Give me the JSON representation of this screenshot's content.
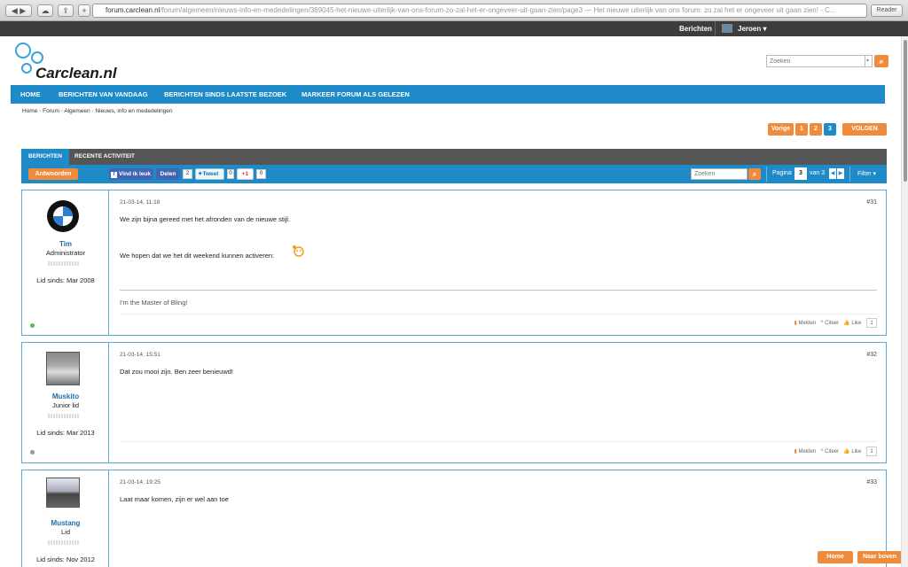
{
  "browser": {
    "url_host": "forum.carclean.nl",
    "url_path": "/forum/algemeen/nieuws-info-en-mededelingen/389045-het-nieuwe-uiterlijk-van-ons-forum-zo-zal-het-er-ongeveer-uit-gaan-zien/page3 — Het nieuwe uiterlijk van ons forum: zo zal het er ongeveer uit gaan zien! - C...",
    "reader": "Reader"
  },
  "topbar": {
    "berichten": "Berichten",
    "user": "Jeroen"
  },
  "logo": "Carclean.nl",
  "search": {
    "placeholder": "Zoeken"
  },
  "nav": {
    "items": [
      "HOME",
      "BERICHTEN VAN VANDAAG",
      "BERICHTEN SINDS LAATSTE BEZOEK",
      "MARKEER FORUM ALS GELEZEN"
    ]
  },
  "breadcrumb": {
    "items": [
      "Home",
      "Forum",
      "Algemeen",
      "Nieuws, info en mededelingen"
    ]
  },
  "pagination": {
    "prev": "Vorige",
    "pages": [
      "1",
      "2",
      "3"
    ],
    "follow": "VOLGEN"
  },
  "tabs": [
    "BERICHTEN",
    "RECENTE ACTIVITEIT"
  ],
  "toolbar": {
    "reply": "Antwoorden",
    "fb_like": "Vind ik leuk",
    "share": "Delen",
    "share_count": "2",
    "tweet": "Tweet",
    "tweet_count": "0",
    "gplus": "+1",
    "gplus_count": "0",
    "search_placeholder": "Zoeken",
    "page_label": "Pagina",
    "page_value": "3",
    "page_of": "van 3",
    "filter": "Filter"
  },
  "posts": [
    {
      "name": "Tim",
      "role": "Administrator",
      "since": "Lid sinds: Mar 2008",
      "date": "21-03-14, 11:18",
      "number": "#31",
      "lines": [
        "We zijn bijna gereed met het afronden van de nieuwe stijl.",
        "We hopen dat we het dit weekend kunnen activeren:"
      ],
      "signature": "I'm the Master of Bling!",
      "online_color": "#5cb85c"
    },
    {
      "name": "Muskito",
      "role": "Junior lid",
      "since": "Lid sinds: Mar 2013",
      "date": "21-03-14, 15:51",
      "number": "#32",
      "lines": [
        "Dat zou mooi zijn. Ben zeer benieuwd!"
      ],
      "online_color": "#999999"
    },
    {
      "name": "Mustang",
      "role": "Lid",
      "since": "Lid sinds: Nov 2012",
      "date": "21-03-14, 19:25",
      "number": "#33",
      "lines": [
        "Laat maar komen, zijn er wel aan toe"
      ]
    }
  ],
  "post_actions": {
    "report": "Melden",
    "quote": "Citeer",
    "like": "Like",
    "like_count": "1"
  },
  "footer_buttons": {
    "home": "Home",
    "top": "Naar boven"
  },
  "colors": {
    "accent": "#1e8ac7",
    "orange": "#f08b3b"
  }
}
